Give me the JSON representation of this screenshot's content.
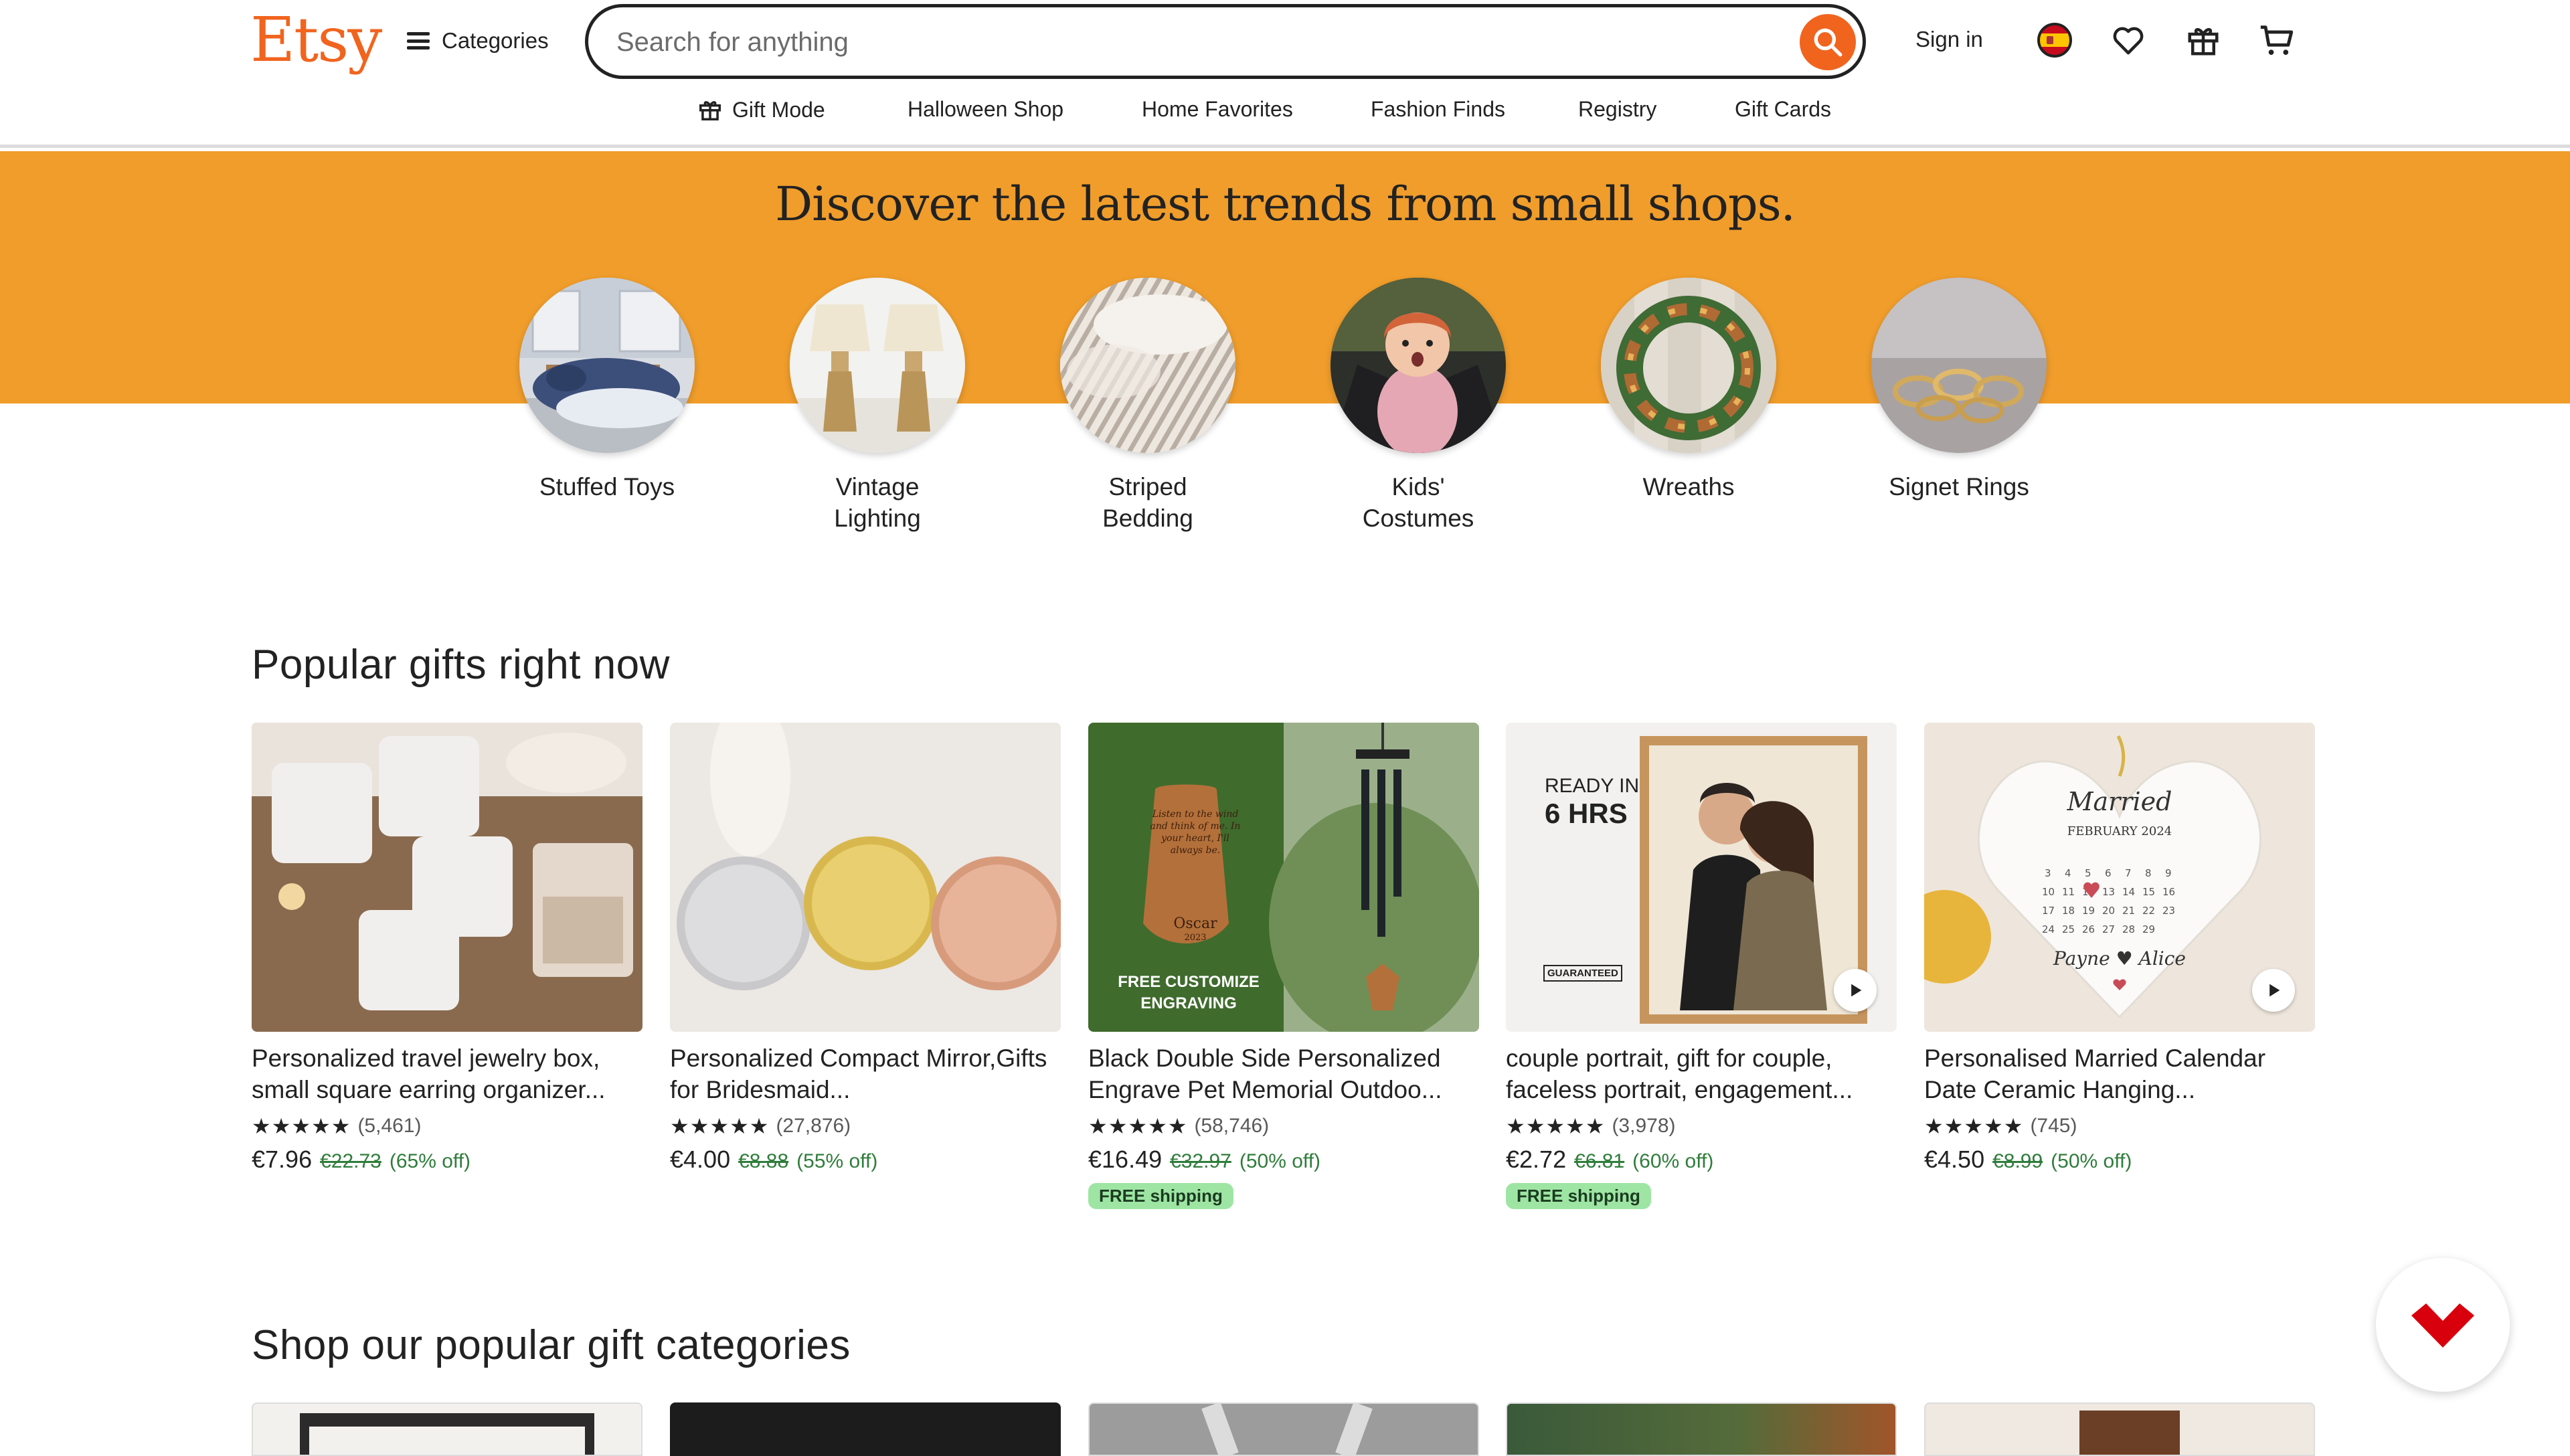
{
  "header": {
    "logo": "Etsy",
    "categories_label": "Categories",
    "search_placeholder": "Search for anything",
    "sign_in": "Sign in"
  },
  "subnav": {
    "items": [
      "Gift Mode",
      "Halloween Shop",
      "Home Favorites",
      "Fashion Finds",
      "Registry",
      "Gift Cards"
    ]
  },
  "banner": {
    "title": "Discover the latest trends from small shops.",
    "circles": [
      {
        "label": "Stuffed Toys"
      },
      {
        "label": "Vintage\nLighting"
      },
      {
        "label": "Striped\nBedding"
      },
      {
        "label": "Kids'\nCostumes"
      },
      {
        "label": "Wreaths"
      },
      {
        "label": "Signet Rings"
      }
    ]
  },
  "popular": {
    "title": "Popular gifts right now",
    "products": [
      {
        "title": "Personalized travel jewelry box, small square earring organizer...",
        "stars": "★★★★★",
        "reviews": "(5,461)",
        "price": "€7.96",
        "old_price": "€22.73",
        "discount": "(65% off)",
        "free_shipping": ""
      },
      {
        "title": "Personalized Compact Mirror,Gifts for Bridesmaid...",
        "stars": "★★★★★",
        "reviews": "(27,876)",
        "price": "€4.00",
        "old_price": "€8.88",
        "discount": "(55% off)",
        "free_shipping": ""
      },
      {
        "title": "Black Double Side Personalized Engrave Pet Memorial Outdoo...",
        "stars": "★★★★★",
        "reviews": "(58,746)",
        "price": "€16.49",
        "old_price": "€32.97",
        "discount": "(50% off)",
        "free_shipping": "FREE shipping"
      },
      {
        "title": "couple portrait, gift for couple, faceless portrait, engagement...",
        "stars": "★★★★★",
        "reviews": "(3,978)",
        "price": "€2.72",
        "old_price": "€6.81",
        "discount": "(60% off)",
        "free_shipping": "FREE shipping"
      },
      {
        "title": "Personalised Married Calendar Date Ceramic Hanging...",
        "stars": "★★★★★",
        "reviews": "(745)",
        "price": "€4.50",
        "old_price": "€8.99",
        "discount": "(50% off)",
        "free_shipping": ""
      }
    ],
    "image_text": {
      "chime_quote": "Listen to the wind and think of me. In your heart, I'll always be.",
      "chime_name": "Oscar",
      "chime_year": "2023",
      "chime_banner": "FREE CUSTOMIZE ENGRAVING",
      "portrait_ready": "READY IN",
      "portrait_hours": "6 HRS",
      "portrait_badge": "GUARANTEED",
      "calendar_script": "Married",
      "calendar_month": "FEBRUARY 2024",
      "calendar_names": "Payne ♥ Alice"
    }
  },
  "categories_section": {
    "title": "Shop our popular gift categories"
  },
  "colors": {
    "brand": "#f1641e",
    "banner": "#f09d2b",
    "discount": "#2f7d3b",
    "free_shipping_bg": "#9ee5a4"
  },
  "icons": [
    "hamburger-icon",
    "search-icon",
    "flag-icon",
    "heart-icon",
    "gift-icon",
    "cart-icon",
    "play-icon",
    "help-bubble-icon"
  ]
}
